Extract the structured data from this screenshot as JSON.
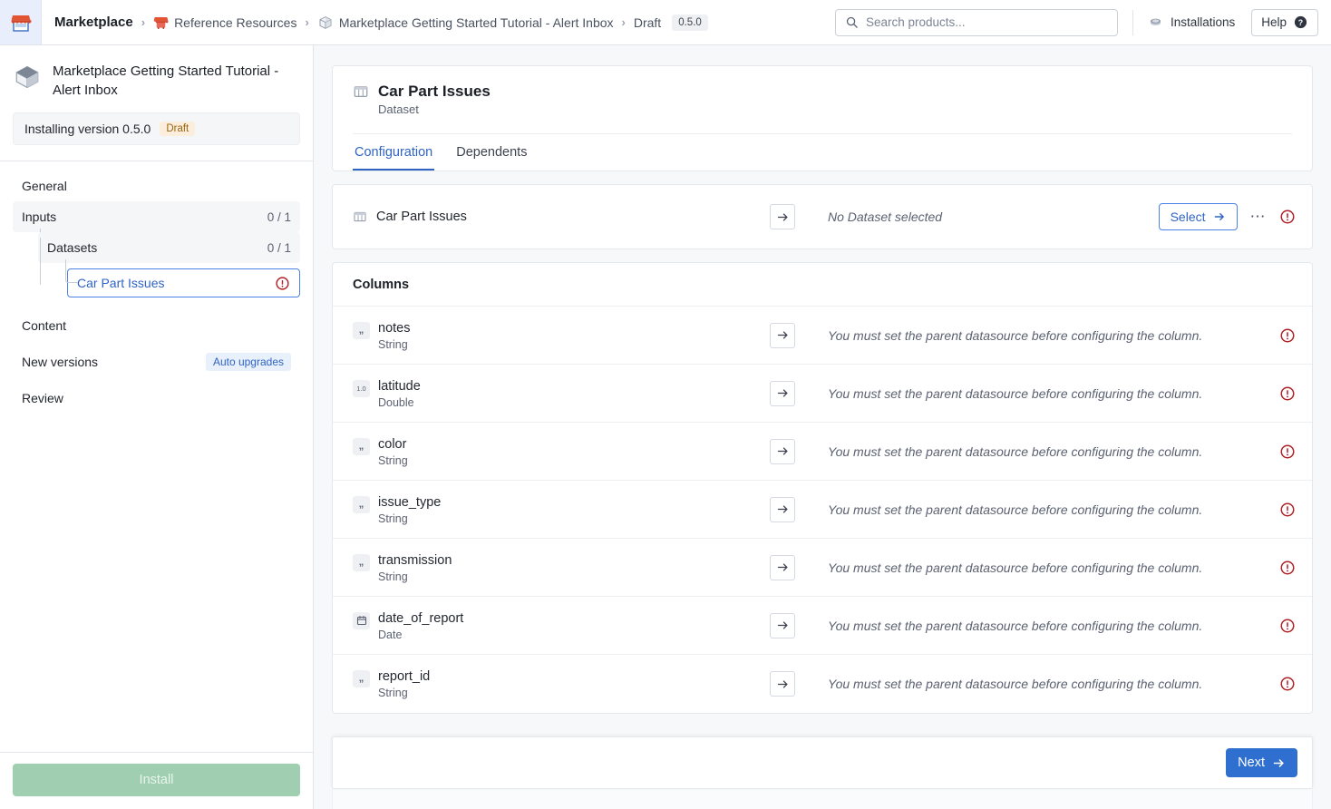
{
  "topbar": {
    "logo_icon": "marketplace-storefront-icon",
    "breadcrumb": {
      "root": "Marketplace",
      "separator": "›",
      "items": [
        {
          "label": "Reference Resources",
          "icon": "storefront-icon"
        },
        {
          "label": "Marketplace Getting Started Tutorial - Alert Inbox",
          "icon": "package-box-icon"
        },
        {
          "label": "Draft",
          "icon": null
        }
      ],
      "version_badge": "0.5.0"
    },
    "search": {
      "placeholder": "Search products...",
      "value": "",
      "icon": "search-icon"
    },
    "installations": {
      "label": "Installations",
      "icon": "installations-icon"
    },
    "help": {
      "label": "Help",
      "icon": "help-circle-icon"
    }
  },
  "sidebar": {
    "product_icon": "package-box-icon",
    "product_title": "Marketplace Getting Started Tutorial - Alert Inbox",
    "installing_version": "Installing version 0.5.0",
    "status_pill": "Draft",
    "nav": [
      {
        "label": "General",
        "count": "",
        "level": 0,
        "shaded": false,
        "selected": false
      },
      {
        "label": "Inputs",
        "count": "0 / 1",
        "level": 0,
        "shaded": true,
        "selected": false
      },
      {
        "label": "Datasets",
        "count": "0 / 1",
        "level": 1,
        "shaded": true,
        "selected": false
      },
      {
        "label": "Car Part Issues",
        "count": "",
        "level": 2,
        "shaded": false,
        "selected": true
      },
      {
        "label": "Content",
        "count": "",
        "level": 0,
        "shaded": false,
        "selected": false
      },
      {
        "label": "New versions",
        "count": "",
        "level": 0,
        "shaded": false,
        "selected": false,
        "pill": "Auto upgrades"
      },
      {
        "label": "Review",
        "count": "",
        "level": 0,
        "shaded": false,
        "selected": false
      }
    ],
    "install_button": "Install"
  },
  "main": {
    "header": {
      "icon": "dataset-table-icon",
      "title": "Car Part Issues",
      "subtitle": "Dataset"
    },
    "tabs": [
      {
        "label": "Configuration",
        "active": true
      },
      {
        "label": "Dependents",
        "active": false
      }
    ],
    "dataset_row": {
      "icon": "dataset-table-icon",
      "name": "Car Part Issues",
      "arrow_icon": "arrow-right-icon",
      "status": "No Dataset selected",
      "select_label": "Select",
      "overflow_icon": "ellipsis-icon",
      "error_icon": "error-circle-icon"
    },
    "columns_section": {
      "title": "Columns",
      "error_message": "You must set the parent datasource before configuring the column.",
      "rows": [
        {
          "name": "notes",
          "type": "String",
          "type_icon": "quote-icon"
        },
        {
          "name": "latitude",
          "type": "Double",
          "type_icon": "decimal-icon"
        },
        {
          "name": "color",
          "type": "String",
          "type_icon": "quote-icon"
        },
        {
          "name": "issue_type",
          "type": "String",
          "type_icon": "quote-icon"
        },
        {
          "name": "transmission",
          "type": "String",
          "type_icon": "quote-icon"
        },
        {
          "name": "date_of_report",
          "type": "Date",
          "type_icon": "calendar-icon"
        },
        {
          "name": "report_id",
          "type": "String",
          "type_icon": "quote-icon"
        }
      ]
    },
    "footer": {
      "next_label": "Next",
      "next_icon": "arrow-right-icon"
    }
  },
  "colors": {
    "accent_blue": "#2f63c4",
    "primary_button": "#2f6fd0",
    "error_red": "#b01f25",
    "draft_amber": "#9a6514",
    "install_green": "#9fcfb0",
    "logo_orange": "#e25432",
    "page_bg": "#f7f8fa"
  }
}
